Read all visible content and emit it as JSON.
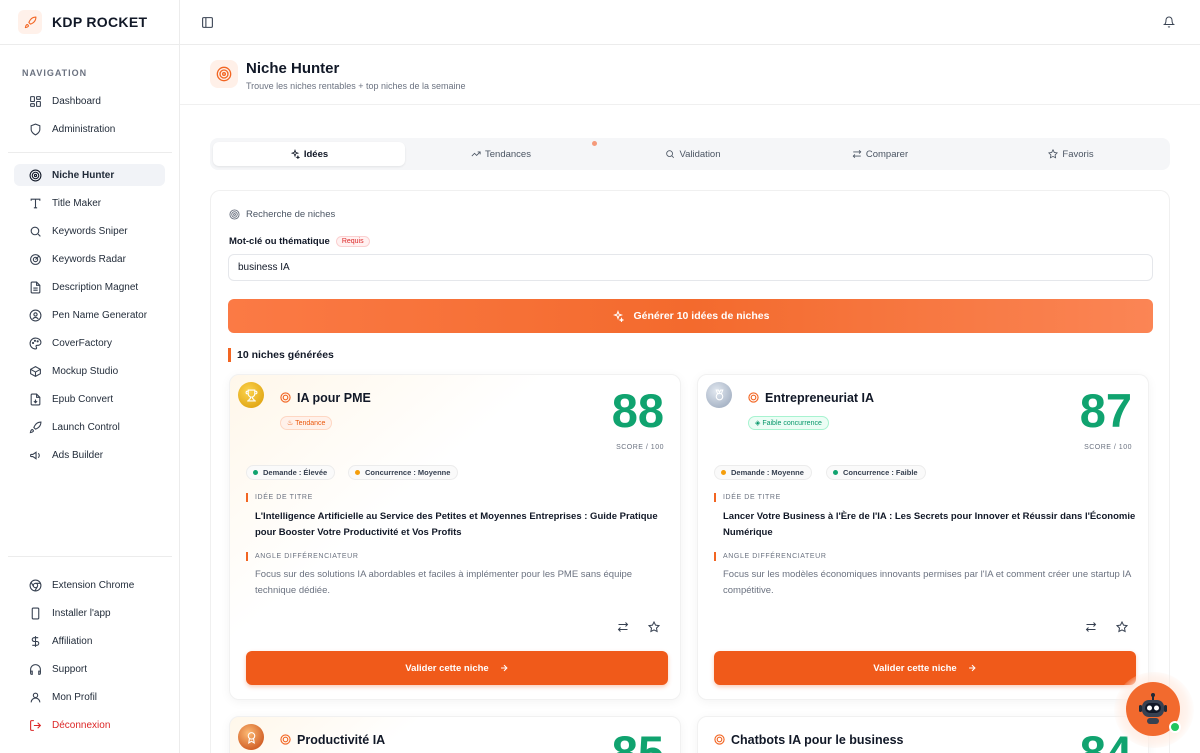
{
  "brand": {
    "name": "KDP ROCKET",
    "icon": "rocket-icon"
  },
  "sidebar": {
    "heading": "NAVIGATION",
    "items": [
      {
        "label": "Dashboard",
        "icon": "grid-icon"
      },
      {
        "label": "Administration",
        "icon": "shield-icon"
      },
      {
        "label": "Niche Hunter",
        "icon": "target-icon",
        "active": true
      },
      {
        "label": "Title Maker",
        "icon": "text-icon"
      },
      {
        "label": "Keywords Sniper",
        "icon": "search-icon"
      },
      {
        "label": "Keywords Radar",
        "icon": "radar-icon"
      },
      {
        "label": "Description Magnet",
        "icon": "file-text-icon"
      },
      {
        "label": "Pen Name Generator",
        "icon": "user-pen-icon"
      },
      {
        "label": "CoverFactory",
        "icon": "palette-icon"
      },
      {
        "label": "Mockup Studio",
        "icon": "box-icon"
      },
      {
        "label": "Epub Convert",
        "icon": "file-convert-icon"
      },
      {
        "label": "Launch Control",
        "icon": "rocket-icon"
      },
      {
        "label": "Ads Builder",
        "icon": "megaphone-icon"
      }
    ],
    "footer_items": [
      {
        "label": "Extension Chrome",
        "icon": "chrome-icon"
      },
      {
        "label": "Installer l'app",
        "icon": "smartphone-icon"
      },
      {
        "label": "Affiliation",
        "icon": "dollar-icon"
      },
      {
        "label": "Support",
        "icon": "headphones-icon"
      },
      {
        "label": "Mon Profil",
        "icon": "user-icon"
      },
      {
        "label": "Déconnexion",
        "icon": "logout-icon"
      }
    ]
  },
  "page": {
    "title": "Niche Hunter",
    "subtitle": "Trouve les niches rentables + top niches de la semaine"
  },
  "tabs": [
    {
      "label": "Idées",
      "icon": "sparkles-icon",
      "active": true
    },
    {
      "label": "Tendances",
      "icon": "trending-up-icon"
    },
    {
      "label": "Validation",
      "icon": "search-icon"
    },
    {
      "label": "Comparer",
      "icon": "compare-arrows-icon"
    },
    {
      "label": "Favoris",
      "icon": "star-icon"
    }
  ],
  "search": {
    "section_label": "Recherche de niches",
    "field_label": "Mot-clé ou thématique",
    "required_badge": "Requis",
    "value": "business IA",
    "generate_label": "Générer 10 idées de niches"
  },
  "results": {
    "title": "10 niches générées",
    "score_suffix": "SCORE / 100",
    "title_idea_label": "IDÉE DE TITRE",
    "angle_label": "ANGLE DIFFÉRENCIATEUR",
    "validate_label": "Valider cette niche",
    "cards": [
      {
        "medal": "gold",
        "name": "IA pour PME",
        "tag": "Tendance",
        "tag_color": "orange",
        "score": "88",
        "demand": "Demande : Élevée",
        "competition": "Concurrence : Moyenne",
        "title_idea": "L'Intelligence Artificielle au Service des Petites et Moyennes Entreprises : Guide Pratique pour Booster Votre Productivité et Vos Profits",
        "angle": "Focus sur des solutions IA abordables et faciles à implémenter pour les PME sans équipe technique dédiée."
      },
      {
        "medal": "silver",
        "name": "Entrepreneuriat IA",
        "tag": "Faible concurrence",
        "tag_color": "green",
        "score": "87",
        "demand": "Demande : Moyenne",
        "competition": "Concurrence : Faible",
        "title_idea": "Lancer Votre Business à l'Ère de l'IA : Les Secrets pour Innover et Réussir dans l'Économie Numérique",
        "angle": "Focus sur les modèles économiques innovants permises par l'IA et comment créer une startup IA compétitive."
      },
      {
        "medal": "bronze",
        "name": "Productivité IA",
        "score": "85"
      },
      {
        "name": "Chatbots IA pour le business",
        "score": "84"
      }
    ]
  },
  "colors": {
    "accent": "#f26522",
    "score": "#10a36f",
    "danger": "#dc2626"
  }
}
